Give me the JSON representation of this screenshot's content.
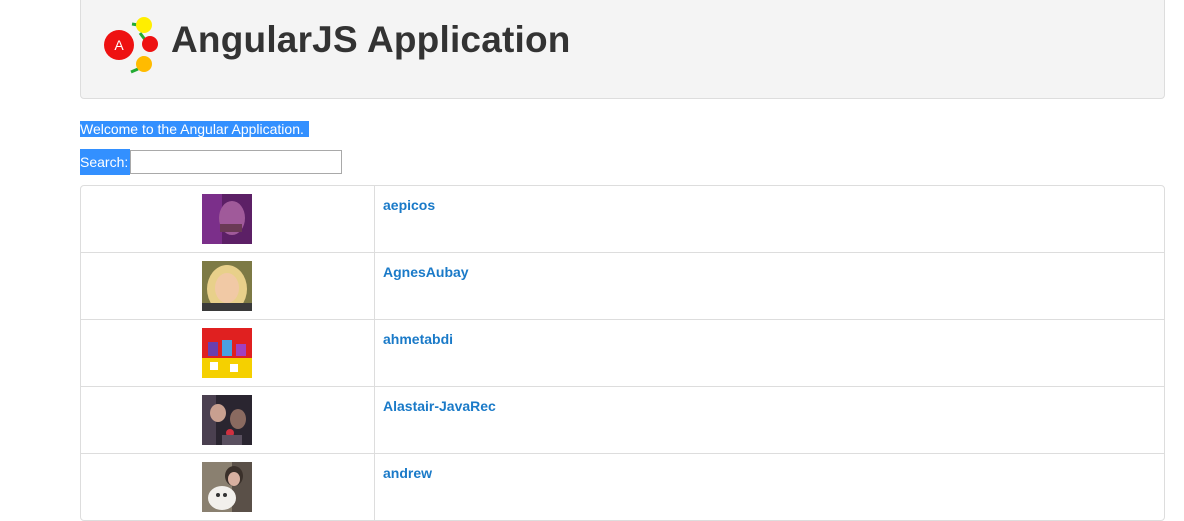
{
  "header": {
    "title": "AngularJS Application",
    "logo_letter": "A"
  },
  "welcome": {
    "text": "Welcome to the Angular Application."
  },
  "search": {
    "label": "Search:",
    "value": "",
    "placeholder": ""
  },
  "users": [
    {
      "username": "aepicos",
      "avatar": "avatar-photo-purple"
    },
    {
      "username": "AgnesAubay",
      "avatar": "avatar-photo-blonde"
    },
    {
      "username": "ahmetabdi",
      "avatar": "avatar-photo-pixel-characters"
    },
    {
      "username": "Alastair-JavaRec",
      "avatar": "avatar-photo-dark-group"
    },
    {
      "username": "andrew",
      "avatar": "avatar-photo-with-dog"
    }
  ],
  "colors": {
    "link": "#1a7ac8",
    "selection_highlight": "#3390ff",
    "header_bg": "#f4f4f4",
    "border": "#dddddd"
  }
}
